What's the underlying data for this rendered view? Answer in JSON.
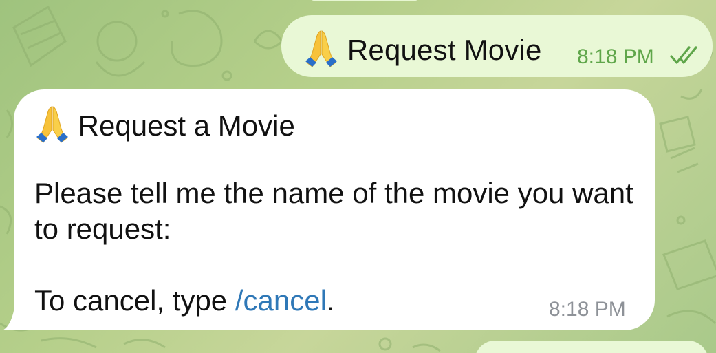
{
  "outgoing_message": {
    "text": "Request Movie",
    "time": "8:18 PM",
    "status_icon": "double-check-icon",
    "emoji": "folded-hands-emoji"
  },
  "incoming_message": {
    "title": "Request a Movie",
    "body": "Please tell me the name of the movie you want to request:",
    "cancel_prefix": "To cancel, type ",
    "cancel_command": "/cancel",
    "cancel_suffix": ".",
    "time": "8:18 PM",
    "emoji": "folded-hands-emoji"
  },
  "colors": {
    "outgoing_bubble": "#e9f8d6",
    "incoming_bubble": "#ffffff",
    "outgoing_time": "#5fa64a",
    "incoming_time": "#8e9298",
    "link": "#2f78b7",
    "background": "#b5cf8a"
  }
}
